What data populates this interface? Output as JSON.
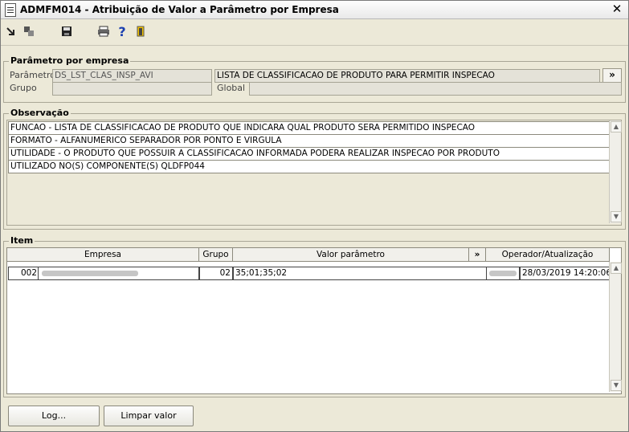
{
  "window": {
    "title": "ADMFM014 - Atribuição de Valor a Parâmetro por Empresa",
    "close_label": "✕"
  },
  "toolbar": {
    "icons": [
      "arrow-in-icon",
      "copy-icon",
      "save-icon",
      "print-icon",
      "help-icon",
      "exit-door-icon"
    ]
  },
  "parametro": {
    "group_label": "Parâmetro por empresa",
    "parametro_label": "Parâmetro",
    "parametro_code": "DS_LST_CLAS_INSP_AVI",
    "parametro_desc": "LISTA DE CLASSIFICACAO DE PRODUTO PARA PERMITIR INSPECAO",
    "expand_label": "»",
    "grupo_label": "Grupo",
    "grupo_value": "",
    "global_label": "Global",
    "global_value": ""
  },
  "observacao": {
    "group_label": "Observação",
    "lines": [
      "FUNCAO - LISTA DE CLASSIFICACAO DE PRODUTO QUE INDICARA QUAL PRODUTO SERA PERMITIDO INSPECAO",
      "FORMATO - ALFANUMERICO SEPARADOR POR PONTO E VIRGULA",
      "UTILIDADE - O PRODUTO QUE POSSUIR A CLASSIFICACAO INFORMADA PODERA REALIZAR INSPECAO POR PRODUTO",
      "UTILIZADO NO(S) COMPONENTE(S) QLDFP044"
    ]
  },
  "item": {
    "group_label": "Item",
    "headers": {
      "empresa": "Empresa",
      "grupo": "Grupo",
      "valor": "Valor parâmetro",
      "expand": "»",
      "operador": "Operador/Atualização"
    },
    "rows": [
      {
        "empresa_code": "002",
        "grupo": "02",
        "valor": "35;01;35;02",
        "data": "28/03/2019 14:20:06"
      }
    ]
  },
  "buttons": {
    "log": "Log...",
    "limpar": "Limpar valor"
  }
}
